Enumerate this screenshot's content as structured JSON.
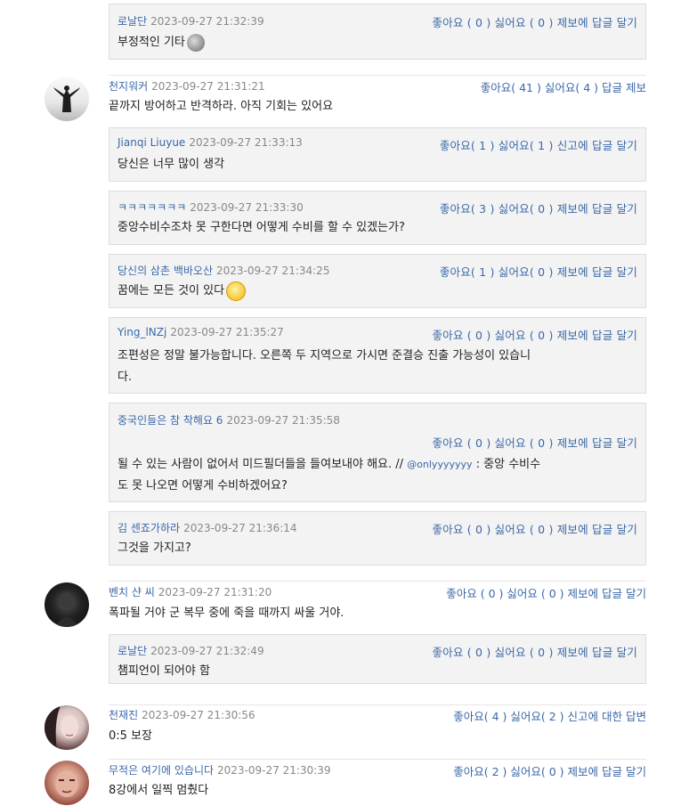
{
  "comments": [
    {
      "user": "로날단",
      "time": "2023-09-27 21:32:39",
      "like": "좋아요 ( 0 )",
      "dislike": "싫어요 ( 0 )",
      "report": "제보에",
      "reply": "답글 달기",
      "text": "부정적인 기타"
    },
    {
      "user": "천지워커",
      "time": "2023-09-27 21:31:21",
      "like": "좋아요( 41 )",
      "dislike": "싫어요( 4 )",
      "reply": "답글",
      "report": "제보",
      "text": "끝까지 방어하고 반격하라. 아직 기회는 있어요",
      "replies": [
        {
          "user": "Jianqi Liuyue",
          "time": "2023-09-27 21:33:13",
          "like": "좋아요( 1 )",
          "dislike": "싫어요( 1 )",
          "report": "신고에",
          "reply": "답글 달기",
          "text": "당신은 너무 많이 생각"
        },
        {
          "user": "ㅋㅋㅋㅋㅋㅋㅋ",
          "time": "2023-09-27 21:33:30",
          "like": "좋아요( 3 )",
          "dislike": "싫어요( 0 )",
          "report": "제보에",
          "reply": "답글 달기",
          "text": "중앙수비수조차 못 구한다면 어떻게 수비를 할 수 있겠는가?"
        },
        {
          "user": "당신의 삼촌 백바오산",
          "time": "2023-09-27 21:34:25",
          "like": "좋아요( 1 )",
          "dislike": "싫어요( 0 )",
          "report": "제보에",
          "reply": "답글 달기",
          "text": "꿈에는 모든 것이 있다"
        },
        {
          "user": "Ying_lNZj",
          "time": "2023-09-27 21:35:27",
          "like": "좋아요 ( 0 )",
          "dislike": "싫어요 ( 0 )",
          "report": "제보에",
          "reply": "답글 달기",
          "text_line1": "조편성은 정말 불가능합니다. 오른쪽 두 지역으로 가시면 준결승 진출 가능성이 있습니",
          "text_line2": "다."
        },
        {
          "user": "중국인들은 참 착해요 6",
          "time": "2023-09-27 21:35:58",
          "like": "좋아요 ( 0 )",
          "dislike": "싫어요 ( 0 )",
          "report": "제보에",
          "reply": "답글 달기",
          "text_line1a": "될 수 있는 사람이 없어서 미드필더들을 들여보내야 해요. // ",
          "mention": "@onlyyyyyyy",
          "text_line1b": " : 중앙 수비수",
          "text_line2": "도 못 나오면 어떻게 수비하겠어요?"
        },
        {
          "user": "김 센죠가하라",
          "time": "2023-09-27 21:36:14",
          "like": "좋아요 ( 0 )",
          "dislike": "싫어요 ( 0 )",
          "report": "제보에",
          "reply": "답글 달기",
          "text": "그것을 가지고?"
        }
      ]
    },
    {
      "user": "벤치 샨 씨",
      "time": "2023-09-27 21:31:20",
      "like": "좋아요 ( 0 )",
      "dislike": "싫어요 ( 0 )",
      "report": "제보에",
      "reply": "답글 달기",
      "text": "폭파될 거야 군 복무 중에 죽을 때까지 싸울 거야.",
      "replies": [
        {
          "user": "로날단",
          "time": "2023-09-27 21:32:49",
          "like": "좋아요 ( 0 )",
          "dislike": "싫어요 ( 0 )",
          "report": "제보에",
          "reply": "답글 달기",
          "text": "챔피언이 되어야 함"
        }
      ]
    },
    {
      "user": "천재진",
      "time": "2023-09-27 21:30:56",
      "like": "좋아요( 4 )",
      "dislike": "싫어요( 2 )",
      "report": "신고에 대한",
      "reply": "답변",
      "text": "0:5 보장"
    },
    {
      "user": "무적은 여기에 있습니다",
      "time": "2023-09-27 21:30:39",
      "like": "좋아요( 2 )",
      "dislike": "싫어요( 0 )",
      "report": "제보에",
      "reply": "답글 달기",
      "text": "8강에서 일찍 멈췄다"
    }
  ]
}
